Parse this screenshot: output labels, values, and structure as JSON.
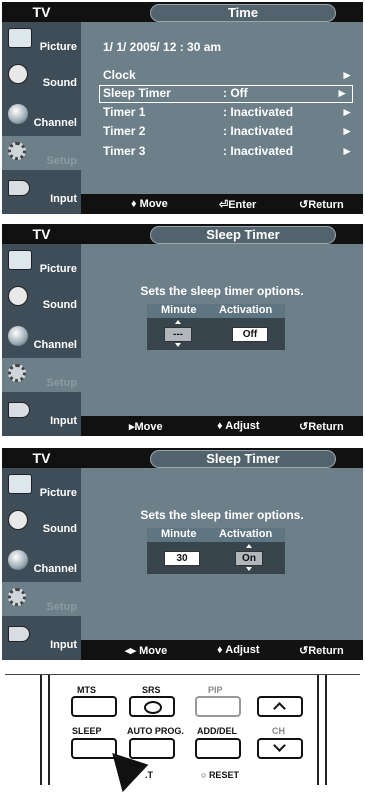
{
  "screen1": {
    "sidebar_title": "TV",
    "sidebar": [
      "Picture",
      "Sound",
      "Channel",
      "Setup",
      "Input"
    ],
    "title": "Time",
    "date": "1/ 1/ 2005/ 12 : 30 am",
    "rows": [
      {
        "label": "Clock",
        "value": "",
        "arrow": "►"
      },
      {
        "label": "Sleep Timer",
        "value": ": Off",
        "arrow": "►"
      },
      {
        "label": "Timer 1",
        "value": ": Inactivated",
        "arrow": "►"
      },
      {
        "label": "Timer 2",
        "value": ": Inactivated",
        "arrow": "►"
      },
      {
        "label": "Timer 3",
        "value": ": Inactivated",
        "arrow": "►"
      }
    ],
    "bottom": {
      "move": "♦ Move",
      "enter": "Enter",
      "ret": "Return"
    }
  },
  "screen2": {
    "sidebar_title": "TV",
    "sidebar": [
      "Picture",
      "Sound",
      "Channel",
      "Setup",
      "Input"
    ],
    "title": "Sleep Timer",
    "intro": "Sets the sleep timer options.",
    "minute_label": "Minute",
    "activation_label": "Activation",
    "minute_value": "---",
    "activation_value": "Off",
    "bottom": {
      "move": "▸Move",
      "adjust": "♦ Adjust",
      "ret": "Return"
    }
  },
  "screen3": {
    "sidebar_title": "TV",
    "sidebar": [
      "Picture",
      "Sound",
      "Channel",
      "Setup",
      "Input"
    ],
    "title": "Sleep Timer",
    "intro": "Sets the sleep timer options.",
    "minute_label": "Minute",
    "activation_label": "Activation",
    "minute_value": "30",
    "activation_value": "On",
    "bottom": {
      "move": "◂▸ Move",
      "adjust": "♦ Adjust",
      "ret": "Return"
    }
  },
  "remote": {
    "mts": "MTS",
    "srs": "SRS",
    "pip": "PIP",
    "sleep": "SLEEP",
    "auto_prog": "AUTO PROG.",
    "add_del": "ADD/DEL",
    "ch": "CH",
    "reset": "RESET",
    "partial": ".T"
  },
  "colors": {
    "panel": "#6d7f89",
    "sidebar": "#3e4d58",
    "bar": "#111111"
  }
}
